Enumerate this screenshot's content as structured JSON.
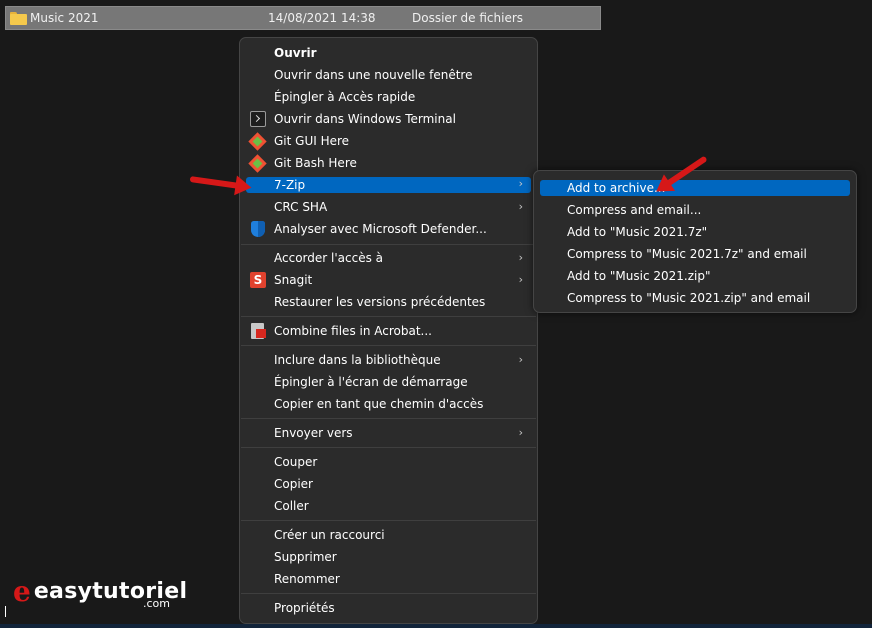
{
  "file_row": {
    "name": "Music 2021",
    "date": "14/08/2021 14:38",
    "type": "Dossier de fichiers",
    "icon": "folder-icon"
  },
  "context_menu": {
    "items": [
      {
        "label": "Ouvrir",
        "bold": true
      },
      {
        "label": "Ouvrir dans une nouvelle fenêtre"
      },
      {
        "label": "Épingler à Accès rapide"
      },
      {
        "label": "Ouvrir dans Windows Terminal",
        "icon": "terminal-icon"
      },
      {
        "label": "Git GUI Here",
        "icon": "git-icon"
      },
      {
        "label": "Git Bash Here",
        "icon": "git-icon"
      },
      {
        "label": "7-Zip",
        "submenu": true,
        "highlighted": true
      },
      {
        "label": "CRC SHA",
        "submenu": true
      },
      {
        "label": "Analyser avec Microsoft Defender...",
        "icon": "defender-icon"
      },
      {
        "label": "Accorder l'accès à",
        "submenu": true
      },
      {
        "label": "Snagit",
        "icon": "snagit-icon",
        "icon_glyph": "S",
        "submenu": true
      },
      {
        "label": "Restaurer les versions précédentes"
      },
      {
        "label": "Combine files in Acrobat...",
        "icon": "acrobat-icon"
      },
      {
        "label": "Inclure dans la bibliothèque",
        "submenu": true
      },
      {
        "label": "Épingler à l'écran de démarrage"
      },
      {
        "label": "Copier en tant que chemin d'accès"
      },
      {
        "label": "Envoyer vers",
        "submenu": true
      },
      {
        "label": "Couper"
      },
      {
        "label": "Copier"
      },
      {
        "label": "Coller"
      },
      {
        "label": "Créer un raccourci"
      },
      {
        "label": "Supprimer"
      },
      {
        "label": "Renommer"
      },
      {
        "label": "Propriétés"
      }
    ],
    "chevron": "›"
  },
  "submenu_7zip": {
    "items": [
      {
        "label": "Add to archive...",
        "highlighted": true
      },
      {
        "label": "Compress and email..."
      },
      {
        "label": "Add to \"Music 2021.7z\""
      },
      {
        "label": "Compress to \"Music 2021.7z\" and email"
      },
      {
        "label": "Add to \"Music 2021.zip\""
      },
      {
        "label": "Compress to \"Music 2021.zip\" and email"
      }
    ]
  },
  "watermark": {
    "mark": "e",
    "name": "easytutoriel",
    "suffix": ".com"
  },
  "colors": {
    "background": "#191919",
    "menu": "#2b2b2b",
    "highlight": "#0067c0",
    "arrow": "#d61818"
  }
}
